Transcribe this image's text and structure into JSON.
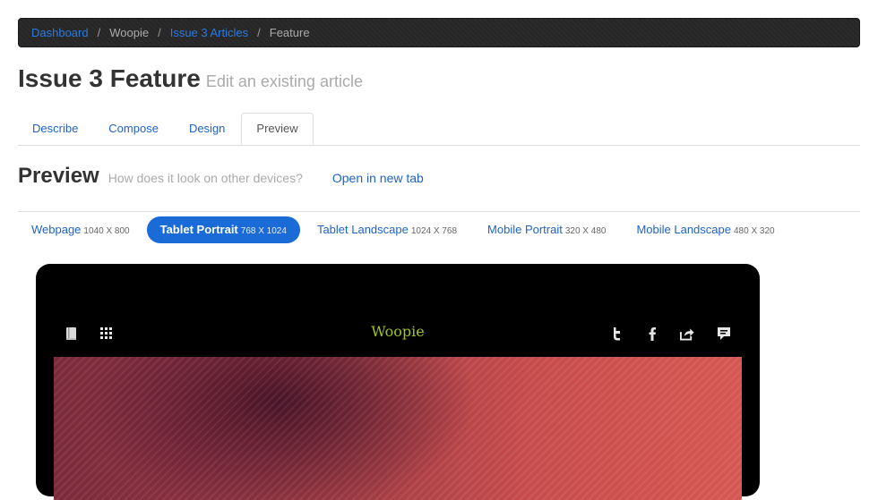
{
  "breadcrumb": {
    "items": [
      {
        "label": "Dashboard",
        "link": true
      },
      {
        "label": "Woopie",
        "link": false
      },
      {
        "label": "Issue 3 Articles",
        "link": true
      },
      {
        "label": "Feature",
        "link": false
      }
    ],
    "separator": "/"
  },
  "header": {
    "title": "Issue 3 Feature",
    "subtitle": "Edit an existing article"
  },
  "tabs": [
    {
      "label": "Describe",
      "active": false
    },
    {
      "label": "Compose",
      "active": false
    },
    {
      "label": "Design",
      "active": false
    },
    {
      "label": "Preview",
      "active": true
    }
  ],
  "preview": {
    "title": "Preview",
    "subtitle": "How does it look on other devices?",
    "open_link": "Open in new tab"
  },
  "devices": [
    {
      "label": "Webpage",
      "dims": "1040 X 800",
      "active": false
    },
    {
      "label": "Tablet Portrait",
      "dims": "768 X 1024",
      "active": true
    },
    {
      "label": "Tablet Landscape",
      "dims": "1024 X 768",
      "active": false
    },
    {
      "label": "Mobile Portrait",
      "dims": "320 X 480",
      "active": false
    },
    {
      "label": "Mobile Landscape",
      "dims": "480 X 320",
      "active": false
    }
  ],
  "app": {
    "title": "Woopie",
    "left_icons": [
      "book-icon",
      "grid-icon"
    ],
    "right_icons": [
      "twitter-icon",
      "facebook-icon",
      "share-icon",
      "comment-icon"
    ],
    "title_color": "#a4c21f"
  },
  "colors": {
    "link": "#1e63c8",
    "active_pill": "#1a6bd8",
    "breadcrumb_bg": "#2b2b2b"
  }
}
